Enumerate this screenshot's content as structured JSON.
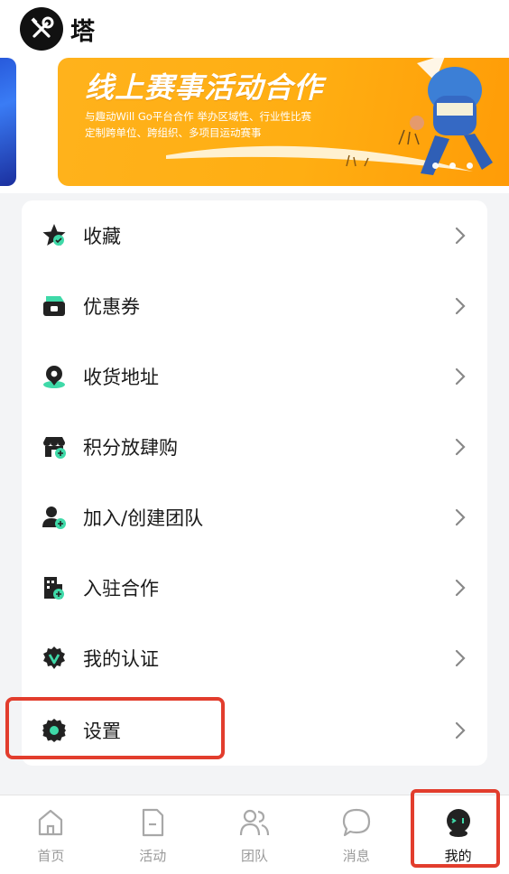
{
  "header": {
    "title": "塔",
    "logo_icon": "wrench-screwdriver-icon"
  },
  "banner": {
    "title": "线上赛事活动合作",
    "subtitle_line1": "与趣动Will Go平台合作 举办区域性、行业性比赛",
    "subtitle_line2": "定制跨单位、跨组织、多项目运动赛事",
    "dots": 3
  },
  "menu": [
    {
      "label": "收藏",
      "icon": "star-icon"
    },
    {
      "label": "优惠券",
      "icon": "coupon-icon"
    },
    {
      "label": "收货地址",
      "icon": "location-pin-icon"
    },
    {
      "label": "积分放肆购",
      "icon": "shop-icon"
    },
    {
      "label": "加入/创建团队",
      "icon": "add-user-icon"
    },
    {
      "label": "入驻合作",
      "icon": "building-icon"
    },
    {
      "label": "我的认证",
      "icon": "verified-badge-icon"
    },
    {
      "label": "设置",
      "icon": "gear-icon"
    }
  ],
  "nav": [
    {
      "label": "首页",
      "icon": "home-icon",
      "active": false
    },
    {
      "label": "活动",
      "icon": "document-icon",
      "active": false
    },
    {
      "label": "团队",
      "icon": "team-icon",
      "active": false
    },
    {
      "label": "消息",
      "icon": "chat-bubble-icon",
      "active": false
    },
    {
      "label": "我的",
      "icon": "robot-avatar-icon",
      "active": true
    }
  ],
  "colors": {
    "accent": "#3fd9a8",
    "dark": "#222222",
    "banner": "#ffae12",
    "highlight": "#e23d2d"
  }
}
